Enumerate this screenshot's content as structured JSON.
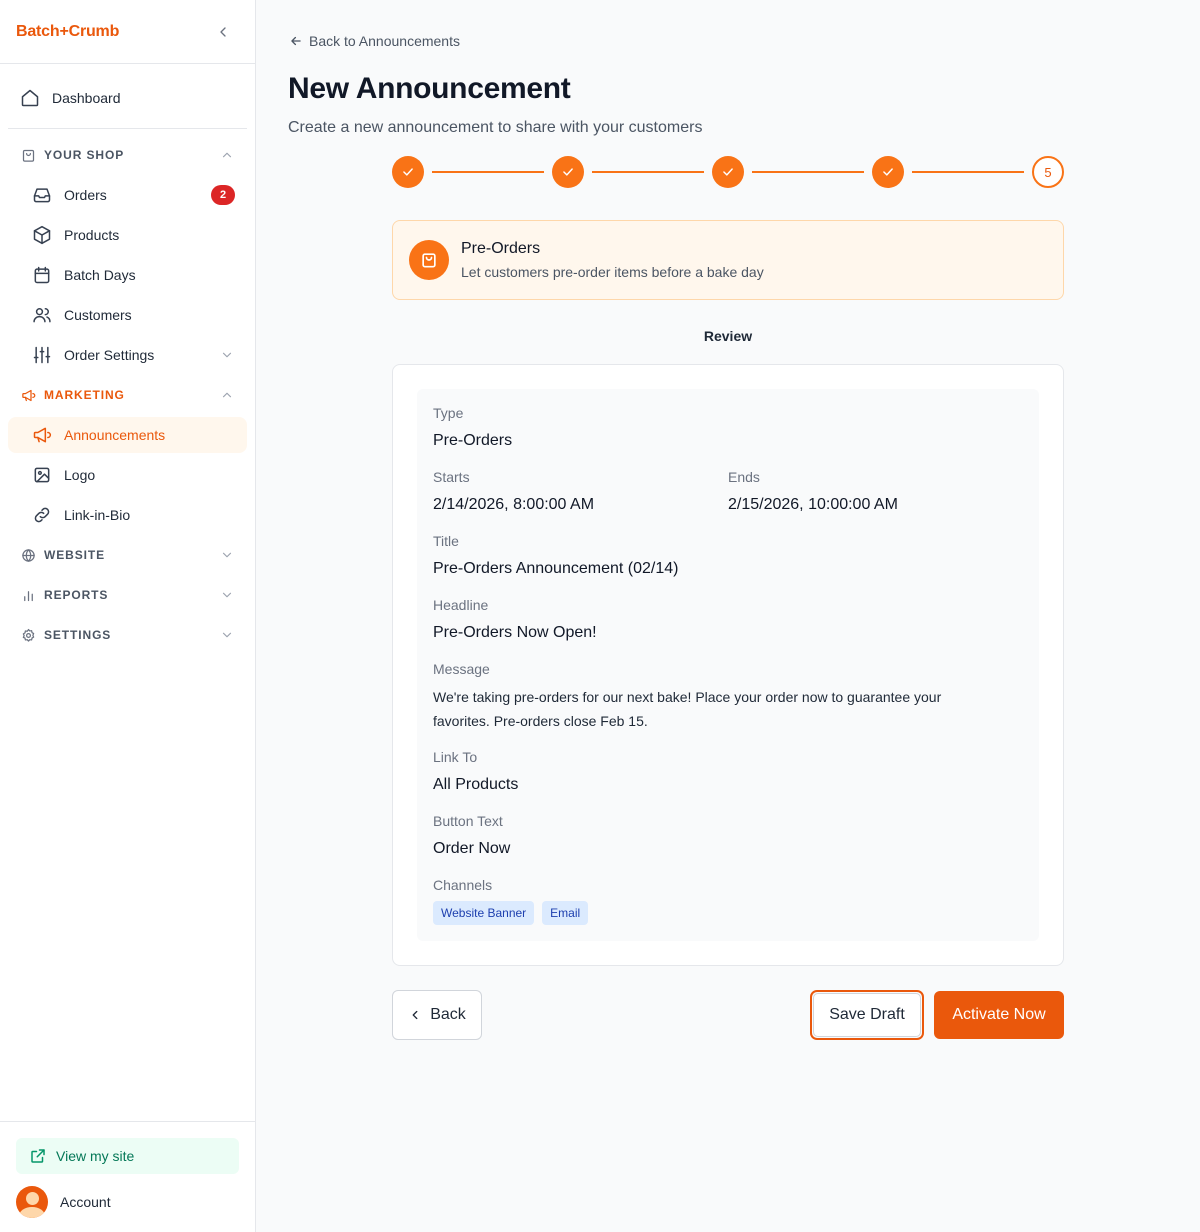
{
  "sidebar": {
    "brand": "Batch+Crumb",
    "dashboard": "Dashboard",
    "your_shop": {
      "label": "YOUR SHOP",
      "orders": "Orders",
      "orders_badge": "2",
      "products": "Products",
      "batch_days": "Batch Days",
      "customers": "Customers",
      "order_settings": "Order Settings"
    },
    "marketing": {
      "label": "MARKETING",
      "announcements": "Announcements",
      "logo": "Logo",
      "link_in_bio": "Link-in-Bio"
    },
    "website": "WEBSITE",
    "reports": "REPORTS",
    "settings": "SETTINGS",
    "view_site": "View my site",
    "account": "Account"
  },
  "main": {
    "back_link": "Back to Announcements",
    "title": "New Announcement",
    "subtitle": "Create a new announcement to share with your customers",
    "stepper": {
      "current_step": "5"
    },
    "type_card": {
      "title": "Pre-Orders",
      "description": "Let customers pre-order items before a bake day"
    },
    "review_heading": "Review",
    "review": {
      "type_label": "Type",
      "type_value": "Pre-Orders",
      "starts_label": "Starts",
      "starts_value": "2/14/2026, 8:00:00 AM",
      "ends_label": "Ends",
      "ends_value": "2/15/2026, 10:00:00 AM",
      "title_label": "Title",
      "title_value": "Pre-Orders Announcement (02/14)",
      "headline_label": "Headline",
      "headline_value": "Pre-Orders Now Open!",
      "message_label": "Message",
      "message_value": "We're taking pre-orders for our next bake! Place your order now to guarantee your favorites. Pre-orders close Feb 15.",
      "link_label": "Link To",
      "link_value": "All Products",
      "button_label": "Button Text",
      "button_value": "Order Now",
      "channels_label": "Channels",
      "channels": [
        "Website Banner",
        "Email"
      ]
    },
    "buttons": {
      "back": "Back",
      "save_draft": "Save Draft",
      "activate": "Activate Now"
    }
  },
  "colors": {
    "accent": "#ea580c",
    "accent_light": "#fff7ed",
    "badge": "#dc2626",
    "chip_bg": "#dbeafe",
    "chip_text": "#1e40af"
  }
}
